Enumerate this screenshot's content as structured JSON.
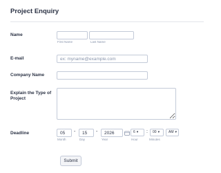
{
  "form": {
    "title": "Project Enquiry",
    "name": {
      "label": "Name",
      "first_value": "",
      "last_value": "",
      "first_sublabel": "First Name",
      "last_sublabel": "Last Name"
    },
    "email": {
      "label": "E-mail",
      "placeholder": "ex: myname@example.com",
      "value": ""
    },
    "company": {
      "label": "Company Name",
      "value": ""
    },
    "project_type": {
      "label": "Explain the Type of Project",
      "value": ""
    },
    "deadline": {
      "label": "Deadline",
      "month": "05",
      "day": "15",
      "year": "2026",
      "separator": "-",
      "hour": "6",
      "minutes": "00",
      "ampm": "AM",
      "time_separator": ":",
      "month_sublabel": "Month",
      "day_sublabel": "Day",
      "year_sublabel": "Year",
      "hour_sublabel": "Hour",
      "minutes_sublabel": "Minutes"
    },
    "submit_label": "Submit"
  },
  "icons": {
    "calendar": "calendar-icon",
    "chevron": "chevron-down-icon"
  },
  "colors": {
    "text": "#2c3345",
    "border": "#c3cad8",
    "muted": "#8894ab"
  }
}
